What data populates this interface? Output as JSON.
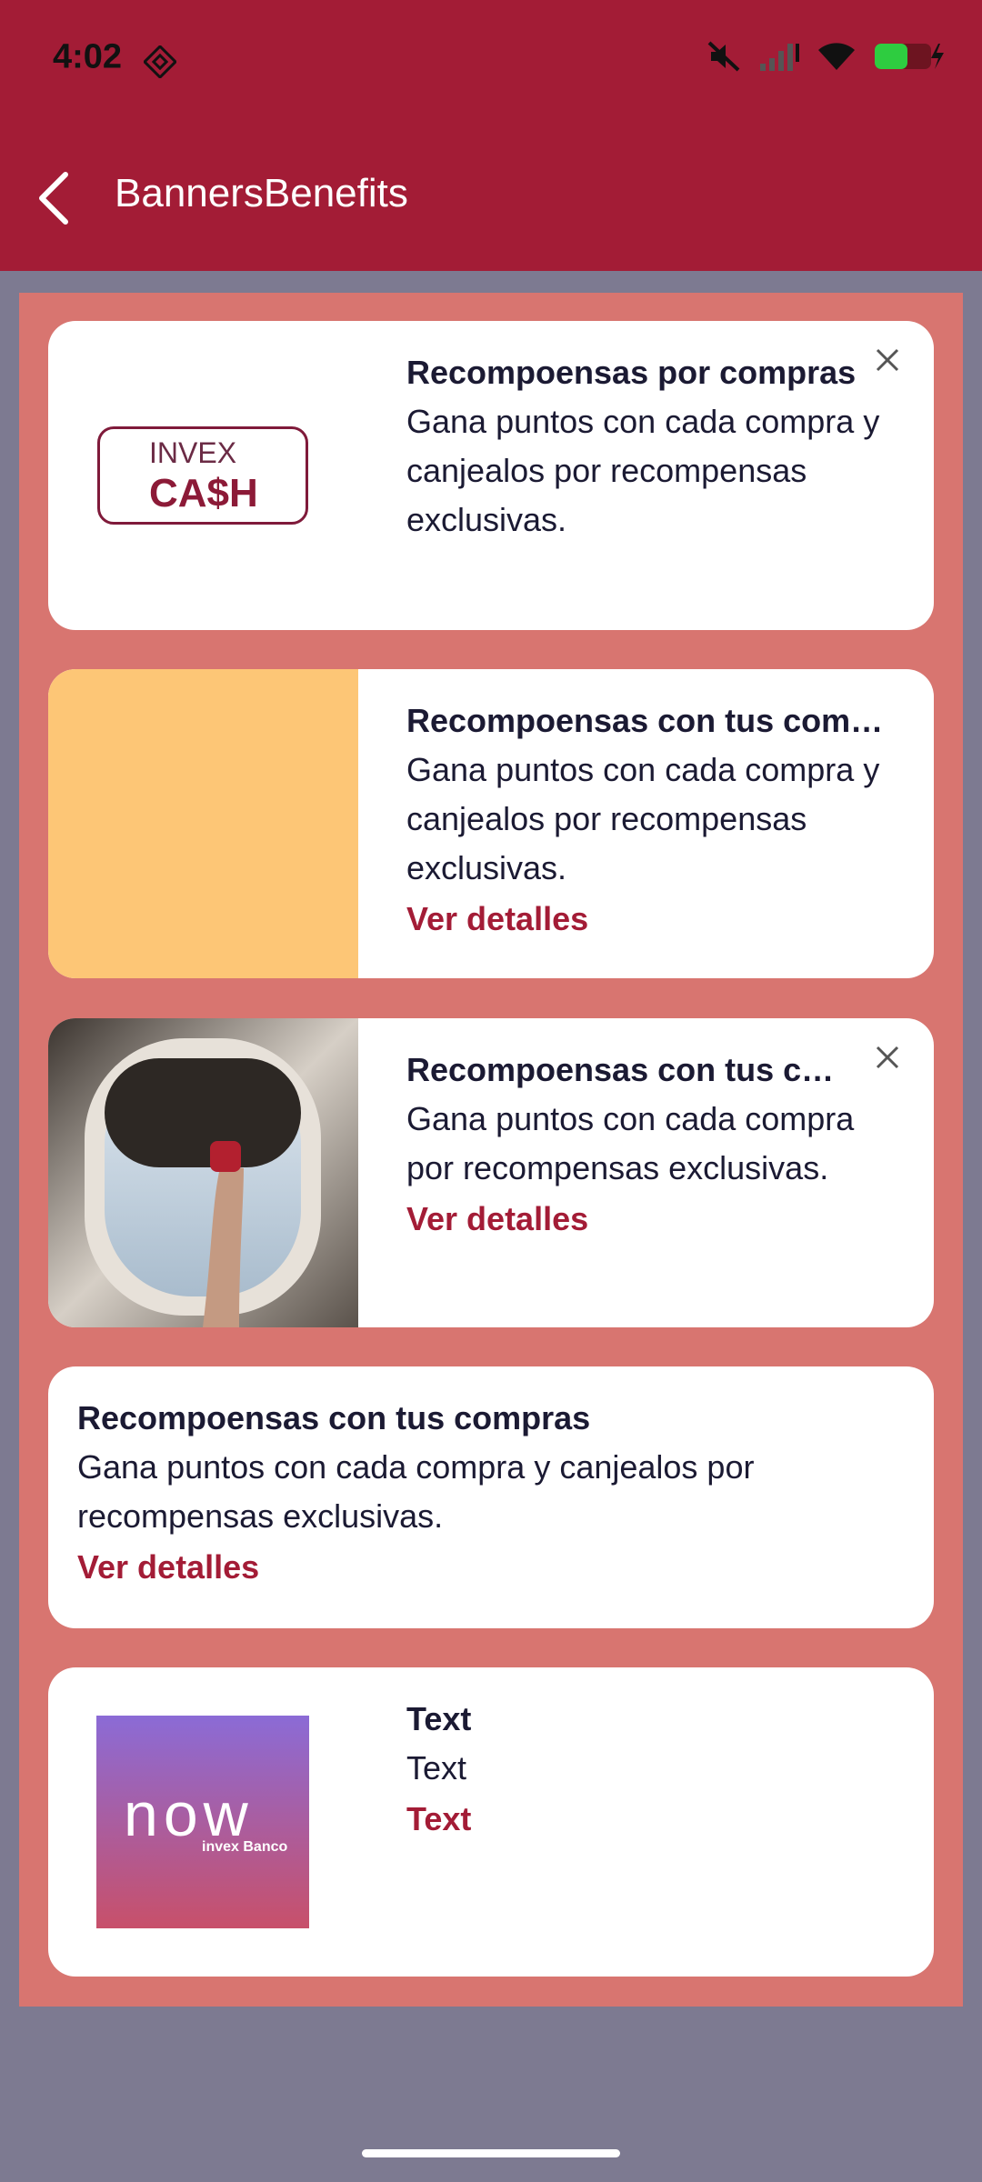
{
  "status_bar": {
    "time": "4:02"
  },
  "appbar": {
    "title": "BannersBenefits"
  },
  "cards": [
    {
      "logo_text_top": "INVEX",
      "logo_text_bottom": "CA$H",
      "title": "Recompoensas por compras",
      "description": "Gana puntos con cada compra y canjealos por recompensas exclusivas."
    },
    {
      "title": "Recompoensas con tus compras",
      "description": "Gana puntos con cada compra y canjealos por recompensas exclusivas.",
      "link": "Ver detalles",
      "image_color": "#fdc676"
    },
    {
      "title": "Recompoensas con tus compras",
      "description": "Gana puntos con cada compra por recompensas exclusivas.",
      "link": "Ver detalles"
    },
    {
      "title": "Recompoensas con tus compras",
      "description": "Gana puntos con cada compra y canjealos por recompensas exclusivas.",
      "link": "Ver detalles"
    },
    {
      "logo_text": "now",
      "logo_subtext": "invex Banco",
      "title": "Text",
      "description": "Text",
      "link": "Text"
    }
  ],
  "colors": {
    "brand": "#a31c36",
    "panel": "#d87570",
    "background": "#7d7a91",
    "text": "#1b1a33"
  }
}
